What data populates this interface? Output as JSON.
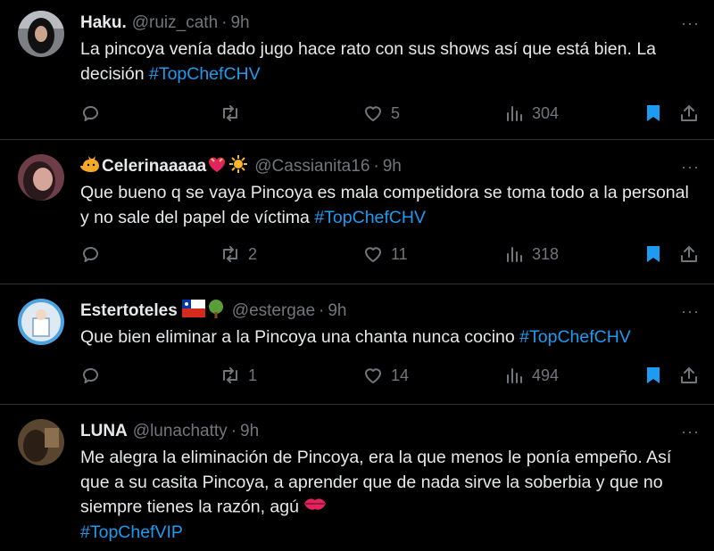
{
  "tweets": [
    {
      "name": "Haku.",
      "handle": "@ruiz_cath",
      "dot": "·",
      "time": "9h",
      "more": "···",
      "text_plain": "La pincoya venía dado jugo hace rato con sus shows así que está bien. La decisión ",
      "hashtag": "#TopChefCHV",
      "replies": "",
      "retweets": "",
      "likes": "5",
      "views": "304",
      "bookmarked": true
    },
    {
      "name_prefix_emoji": "cat",
      "name": "Celerinaaaaa",
      "name_suffix_emojis": [
        "heart-with-ribbon",
        "sun"
      ],
      "handle": "@Cassianita16",
      "dot": "·",
      "time": "9h",
      "more": "···",
      "text_plain": "Que bueno q se vaya Pincoya es mala competidora se toma todo a la personal y no sale del papel de víctima ",
      "hashtag": "#TopChefCHV",
      "replies": "",
      "retweets": "2",
      "likes": "11",
      "views": "318",
      "bookmarked": true
    },
    {
      "name": "Estertoteles",
      "name_suffix_emojis": [
        "chile-flag",
        "tree"
      ],
      "handle": "@estergae",
      "dot": "·",
      "time": "9h",
      "more": "···",
      "text_plain": "Que bien eliminar a la Pincoya una chanta nunca cocino ",
      "hashtag": "#TopChefCHV",
      "replies": "",
      "retweets": "1",
      "likes": "14",
      "views": "494",
      "bookmarked": true
    },
    {
      "name": "LUNA",
      "handle": "@lunachatty",
      "dot": "·",
      "time": "9h",
      "more": "···",
      "text_plain": "Me alegra la eliminación de Pincoya, era la que menos le ponía empeño. Así que a su casita Pincoya, a aprender que de nada sirve la soberbia y que no siempre tienes la razón, agú",
      "text_suffix_emoji": "kiss-mark",
      "hashtag": "#TopChefVIP"
    }
  ],
  "colors": {
    "background": "#000000",
    "text": "#e7e9ea",
    "muted": "#71767b",
    "link": "#1d9bf0",
    "divider": "#2f3336"
  }
}
